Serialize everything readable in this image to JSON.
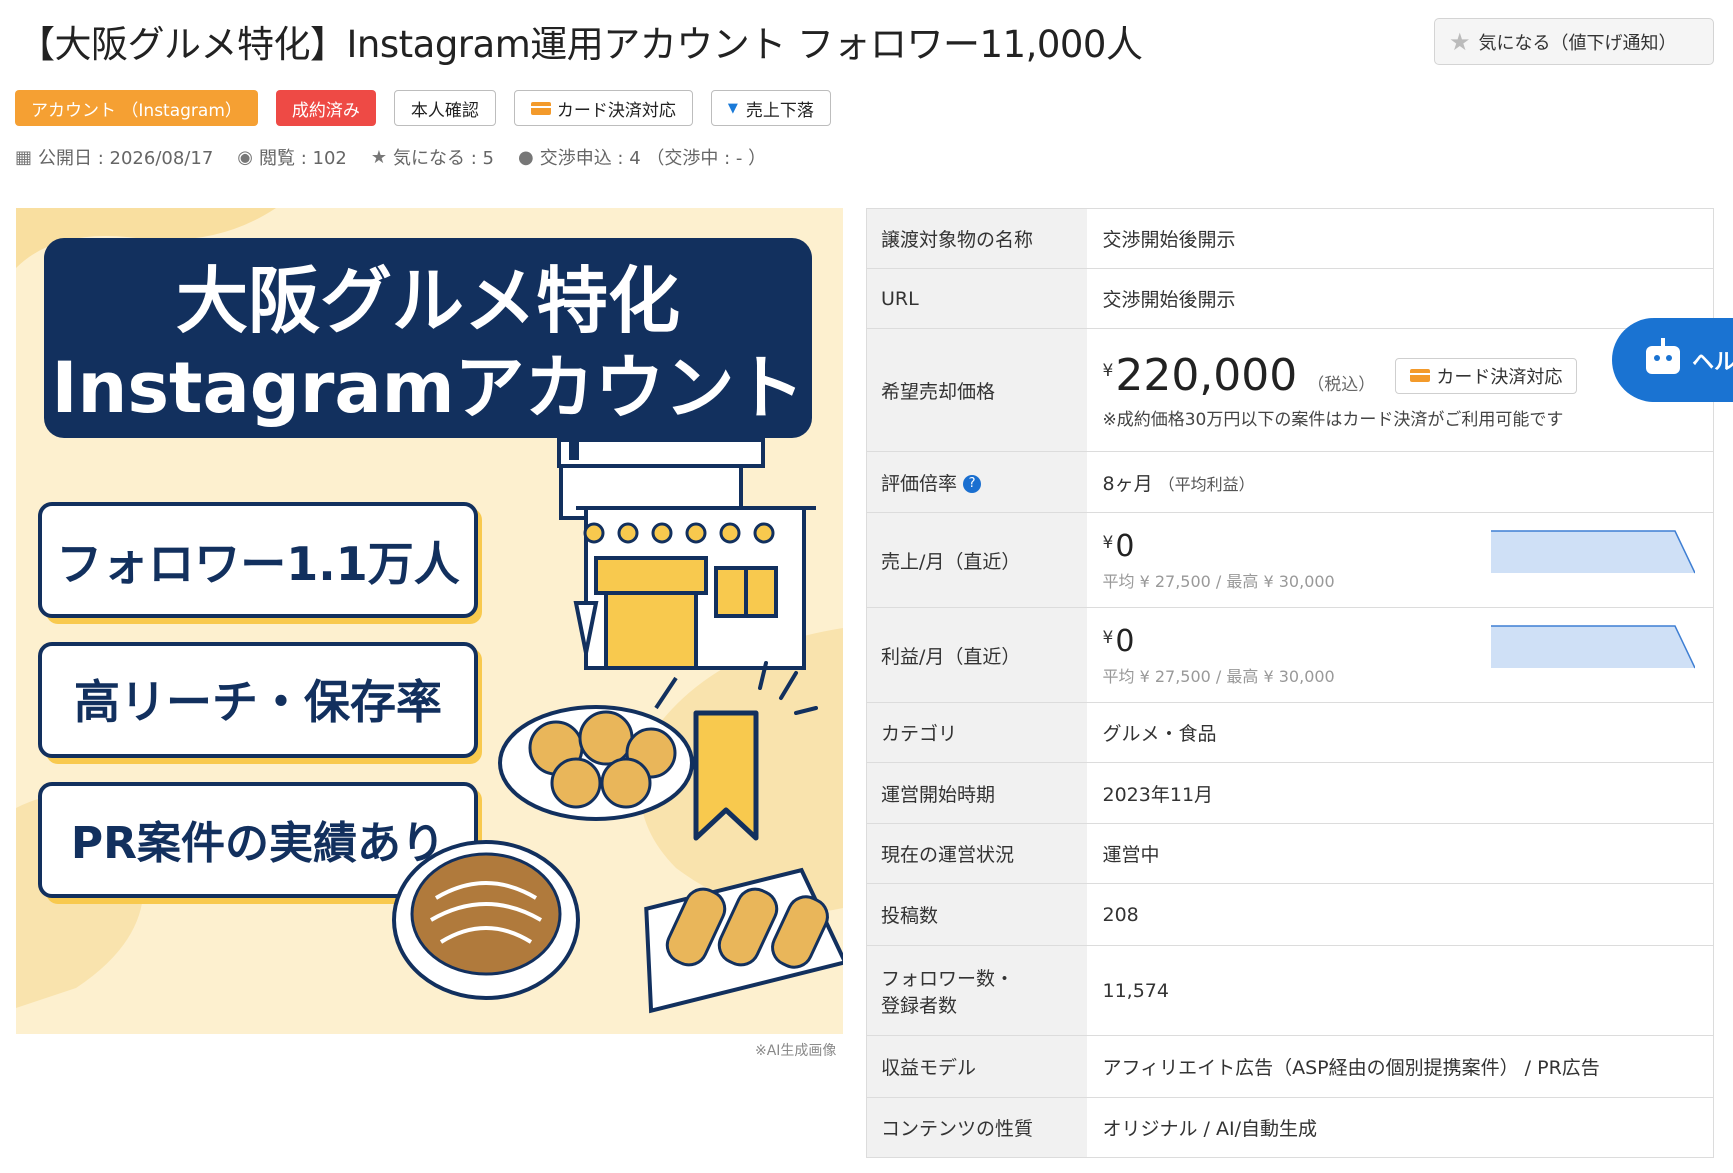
{
  "header": {
    "title": "【大阪グルメ特化】Instagram運用アカウント フォロワー11,000人",
    "favorite_button": "気になる（値下げ通知）"
  },
  "tags": [
    {
      "label": "アカウント （Instagram）",
      "style": "orange"
    },
    {
      "label": "成約済み",
      "style": "red"
    },
    {
      "label": "本人確認",
      "style": "outline"
    },
    {
      "label": "カード決済対応",
      "style": "outline",
      "icon": "card-icon"
    },
    {
      "label": "売上下落",
      "style": "outline",
      "icon": "chevron-down-icon"
    }
  ],
  "meta": {
    "published": "公開日 : 2026/08/17",
    "views": "閲覧 : 102",
    "favorites": "気になる : 5",
    "negotiations": "交渉申込 : 4 （交渉中 : - ）"
  },
  "hero": {
    "headline_line1": "大阪グルメ特化",
    "headline_line2": "Instagramアカウント",
    "point1": "フォロワー1.1万人",
    "point2": "高リーチ・保存率",
    "point3": "PR案件の実績あり",
    "ai_note": "※AI生成画像",
    "colors": {
      "navy": "#12305e",
      "cream": "#fdf0cf",
      "yellow": "#f8c94e"
    }
  },
  "details": {
    "name_label": "譲渡対象物の名称",
    "name_value": "交渉開始後開示",
    "url_label": "URL",
    "url_value": "交渉開始後開示",
    "price_label": "希望売却価格",
    "price_yen": "¥",
    "price_value": "220,000",
    "price_tax": "（税込）",
    "price_card": "カード決済対応",
    "price_note": "※成約価格30万円以下の案件はカード決済がご利用可能です",
    "multiple_label": "評価倍率",
    "multiple_help": "?",
    "multiple_value": "8ヶ月 ",
    "multiple_sub": "（平均利益）",
    "sales_label": "売上/月（直近）",
    "sales_yen": "¥",
    "sales_value": "0",
    "sales_sub": "平均 ¥ 27,500 / 最高 ¥ 30,000",
    "profit_label": "利益/月（直近）",
    "profit_yen": "¥",
    "profit_value": "0",
    "profit_sub": "平均 ¥ 27,500 / 最高 ¥ 30,000",
    "category_label": "カテゴリ",
    "category_value": "グルメ・食品",
    "start_label": "運営開始時期",
    "start_value": "2023年11月",
    "status_label": "現在の運営状況",
    "status_value": "運営中",
    "posts_label": "投稿数",
    "posts_value": "208",
    "followers_label_1": "フォロワー数・",
    "followers_label_2": "登録者数",
    "followers_value": "11,574",
    "revenue_label": "収益モデル",
    "revenue_value": "アフィリエイト広告（ASP経由の個別提携案件） / PR広告",
    "content_label": "コンテンツの性質",
    "content_value": "オリジナル / AI/自動生成"
  },
  "help_widget": {
    "label": "ヘル"
  },
  "accent_colors": {
    "orange": "#f5a033",
    "red": "#ee4a45",
    "blue": "#1a73d2",
    "spark_fill": "#cfe0f6",
    "spark_stroke": "#3f7fd3"
  }
}
